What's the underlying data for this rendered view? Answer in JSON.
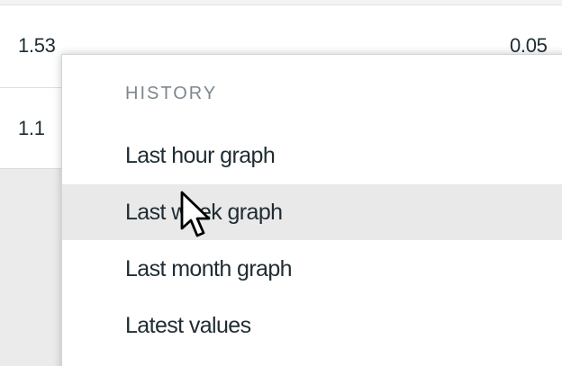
{
  "table": {
    "rows": [
      {
        "left": "1.53",
        "right": "0.05"
      },
      {
        "left": "1.1"
      }
    ]
  },
  "menu": {
    "header": "HISTORY",
    "items": [
      {
        "label": "Last hour graph"
      },
      {
        "label": "Last week graph",
        "highlighted": true
      },
      {
        "label": "Last month graph"
      },
      {
        "label": "Latest values"
      }
    ]
  },
  "cursor": {
    "icon": "arrow-pointer-icon"
  },
  "colors": {
    "text": "#1f2c33",
    "header_text": "#7c878f",
    "hover_bg": "#e9e9e9",
    "lower_area_bg": "#ebebeb"
  }
}
